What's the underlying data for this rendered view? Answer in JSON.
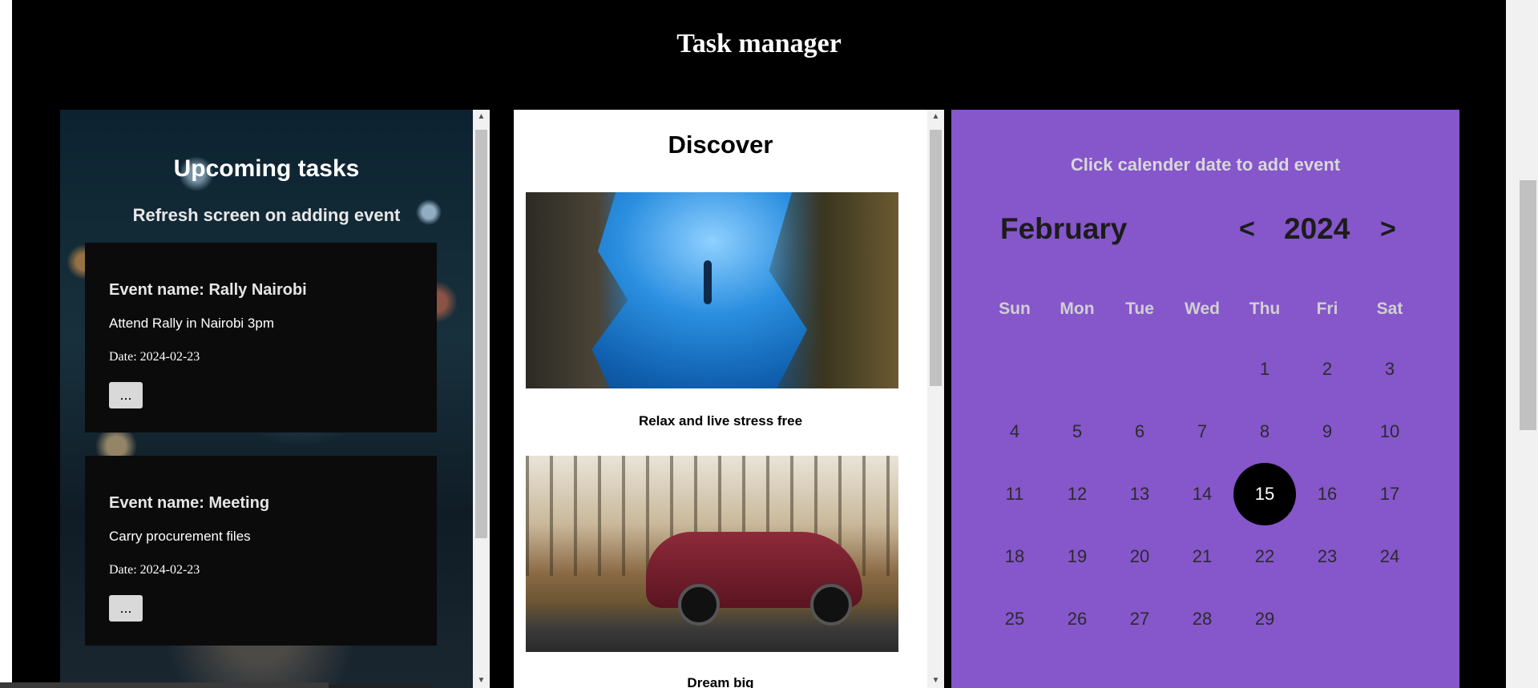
{
  "header": {
    "title": "Task manager"
  },
  "upcoming": {
    "title": "Upcoming tasks",
    "subtitle": "Refresh screen on adding event",
    "events": [
      {
        "name": "Event name: Rally Nairobi",
        "description": "Attend Rally in Nairobi 3pm",
        "date": "Date: 2024-02-23",
        "more_label": "..."
      },
      {
        "name": "Event name: Meeting",
        "description": "Carry procurement files",
        "date": "Date: 2024-02-23",
        "more_label": "..."
      }
    ]
  },
  "discover": {
    "title": "Discover",
    "items": [
      {
        "caption": "Relax and live stress free"
      },
      {
        "caption": "Dream big"
      }
    ]
  },
  "calendar": {
    "hint": "Click calender date to add event",
    "month": "February",
    "year": "2024",
    "prev_icon": "chevron-left-icon",
    "next_icon": "chevron-right-icon",
    "prev_glyph": "<",
    "next_glyph": ">",
    "weekdays": [
      "Sun",
      "Mon",
      "Tue",
      "Wed",
      "Thu",
      "Fri",
      "Sat"
    ],
    "days": [
      "1",
      "2",
      "3",
      "4",
      "5",
      "6",
      "7",
      "8",
      "9",
      "10",
      "11",
      "12",
      "13",
      "14",
      "15",
      "16",
      "17",
      "18",
      "19",
      "20",
      "21",
      "22",
      "23",
      "24",
      "25",
      "26",
      "27",
      "28",
      "29"
    ],
    "selected_day": "15"
  },
  "colors": {
    "calendar_bg": "#8656cb",
    "page_bg": "#000000",
    "card_bg": "#0b0b0b"
  }
}
